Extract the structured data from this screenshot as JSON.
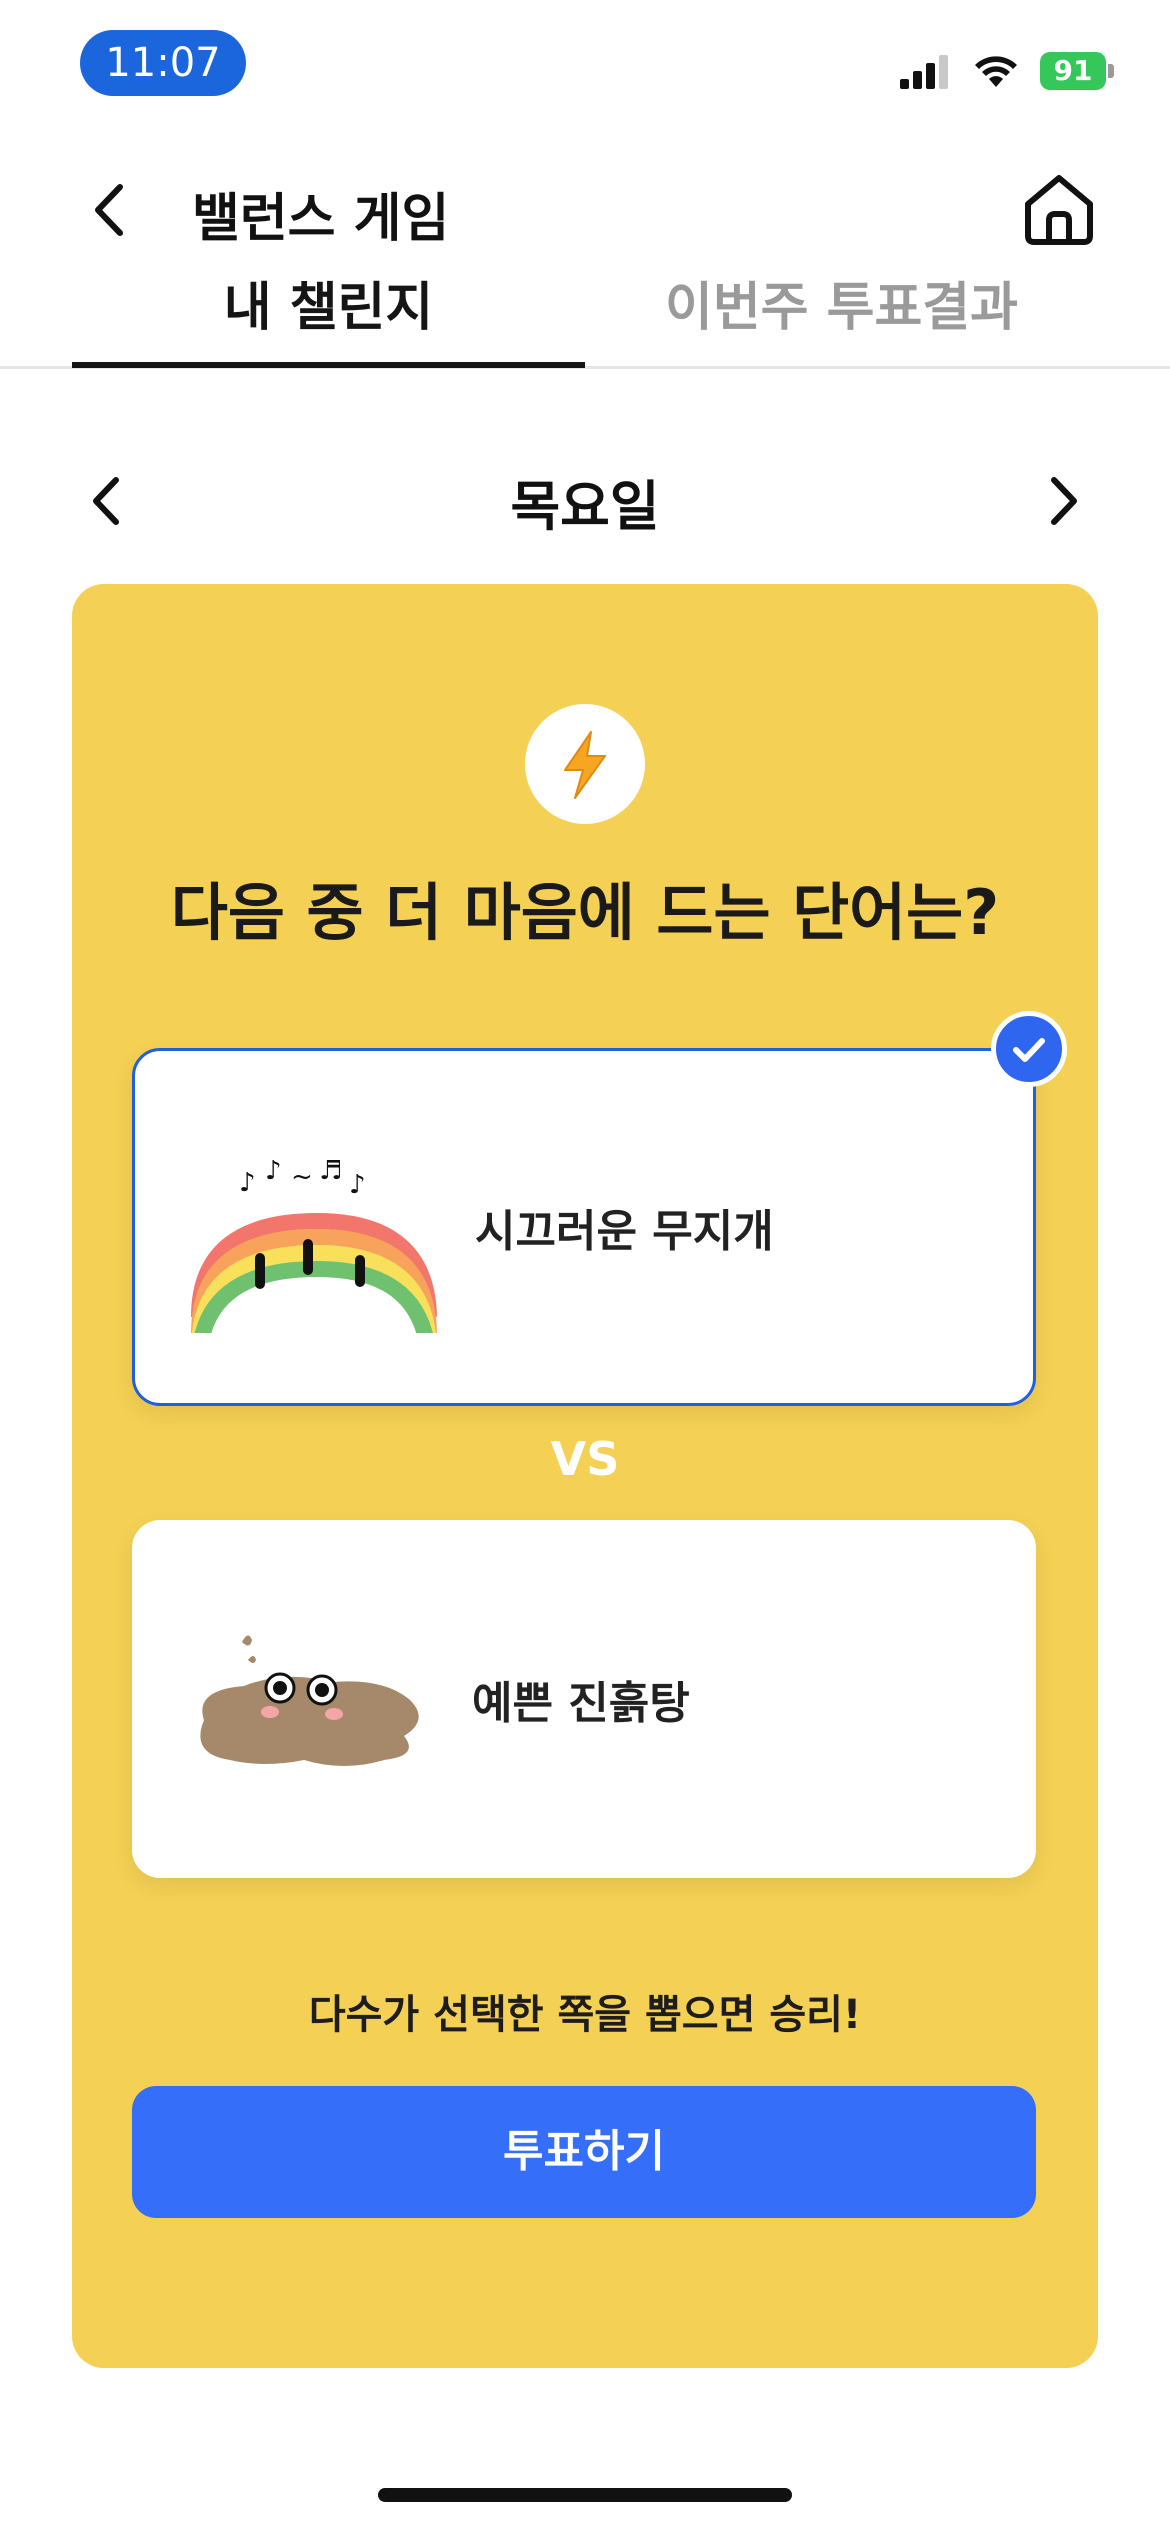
{
  "status_bar": {
    "time": "11:07",
    "battery": "91"
  },
  "header": {
    "title": "밸런스 게임",
    "back_icon": "chevron-left-icon",
    "home_icon": "home-icon"
  },
  "tabs": [
    {
      "label": "내 챌린지",
      "active": true
    },
    {
      "label": "이번주 투표결과",
      "active": false
    }
  ],
  "day_nav": {
    "label": "목요일"
  },
  "challenge": {
    "icon": "lightning-icon",
    "question": "다음 중 더 마음에 드는 단어는?",
    "options": [
      {
        "label": "시끄러운 무지개",
        "selected": true,
        "illustration": "singing-rainbow"
      },
      {
        "label": "예쁜 진흙탕",
        "selected": false,
        "illustration": "mud-puddle"
      }
    ],
    "vs": "VS",
    "hint": "다수가 선택한 쪽을 뽑으면 승리!",
    "vote_button": "투표하기"
  },
  "colors": {
    "card": "#f4d054",
    "accent": "#356ef8",
    "selected_border": "#1f5fe0"
  }
}
